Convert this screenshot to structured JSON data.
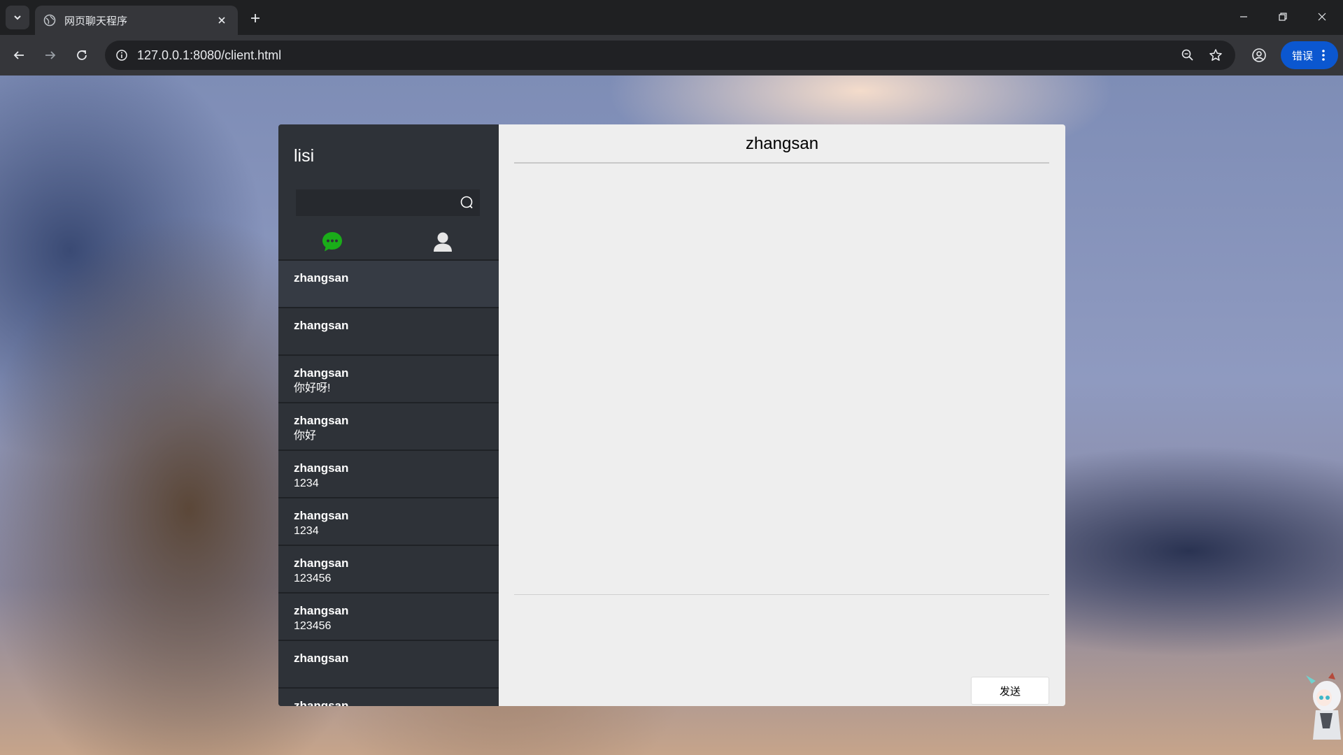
{
  "browser": {
    "tab_title": "网页聊天程序",
    "url": "127.0.0.1:8080/client.html",
    "error_button_label": "错误"
  },
  "icons": {
    "tab_favicon": "globe-icon",
    "tab_close": "close-icon",
    "new_tab": "plus-icon",
    "back": "arrow-left-icon",
    "forward": "arrow-right-icon",
    "reload": "reload-icon",
    "site_info": "info-icon",
    "zoom": "zoom-out-icon",
    "bookmark": "star-icon",
    "profile": "profile-icon",
    "search": "search-icon",
    "chat_tab": "chat-bubble-icon",
    "contacts_tab": "user-icon"
  },
  "colors": {
    "chat_tab_active": "#1aad19",
    "sidebar_bg": "#2e3238",
    "main_bg": "#eeeeee",
    "error_button": "#0b57d0"
  },
  "sidebar": {
    "current_user": "lisi",
    "search_value": "",
    "sessions": [
      {
        "name": "zhangsan",
        "last_message": ""
      },
      {
        "name": "zhangsan",
        "last_message": ""
      },
      {
        "name": "zhangsan",
        "last_message": "你好呀!"
      },
      {
        "name": "zhangsan",
        "last_message": "你好"
      },
      {
        "name": "zhangsan",
        "last_message": "1234"
      },
      {
        "name": "zhangsan",
        "last_message": "1234"
      },
      {
        "name": "zhangsan",
        "last_message": "123456"
      },
      {
        "name": "zhangsan",
        "last_message": "123456"
      },
      {
        "name": "zhangsan",
        "last_message": ""
      },
      {
        "name": "zhangsan",
        "last_message": ""
      }
    ]
  },
  "main": {
    "title": "zhangsan",
    "compose_value": "",
    "send_label": "发送"
  }
}
